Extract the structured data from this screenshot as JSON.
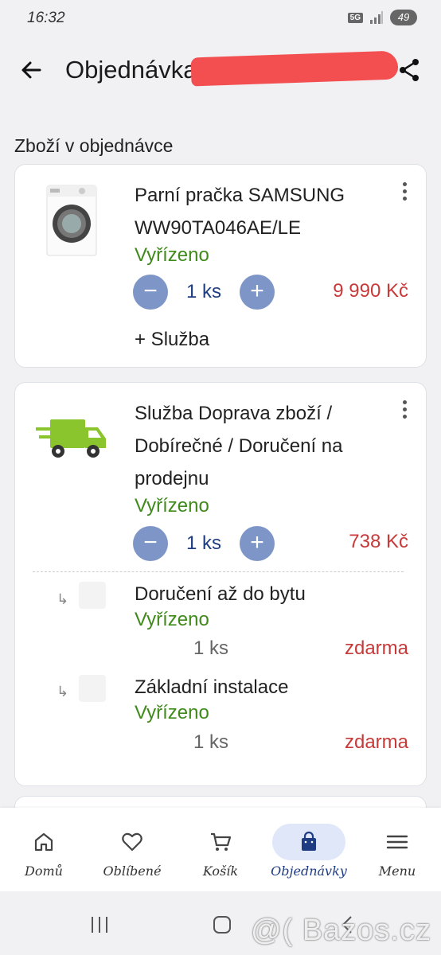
{
  "status_bar": {
    "time": "16:32",
    "network": "5G",
    "battery": "49"
  },
  "header": {
    "title": "Objednávka"
  },
  "section": {
    "title": "Zboží v objednávce"
  },
  "items": [
    {
      "name_line1": "Parní pračka SAMSUNG",
      "name_line2": "WW90TA046AE/LE",
      "status": "Vyřízeno",
      "qty": "1 ks",
      "price": "9 990 Kč",
      "minus": "−",
      "plus": "+",
      "add_service": "+ Služba"
    },
    {
      "name_line1": "Služba Doprava zboží /",
      "name_line2": "Dobírečné / Doručení na",
      "name_line3": "prodejnu",
      "status": "Vyřízeno",
      "qty": "1 ks",
      "price": "738 Kč",
      "minus": "−",
      "plus": "+",
      "sub_items": [
        {
          "arrow": "↳",
          "name": "Doručení až do bytu",
          "status": "Vyřízeno",
          "qty": "1 ks",
          "price": "zdarma"
        },
        {
          "arrow": "↳",
          "name": "Základní instalace",
          "status": "Vyřízeno",
          "qty": "1 ks",
          "price": "zdarma"
        }
      ]
    }
  ],
  "bottom_nav": [
    {
      "label": "Domů",
      "icon": "home-icon"
    },
    {
      "label": "Oblíbené",
      "icon": "heart-icon"
    },
    {
      "label": "Košík",
      "icon": "cart-icon"
    },
    {
      "label": "Objednávky",
      "icon": "bag-icon",
      "active": true
    },
    {
      "label": "Menu",
      "icon": "menu-icon"
    }
  ],
  "watermark": "@( Bazos.cz",
  "colors": {
    "status_green": "#3f8a1a",
    "price_red": "#c83a3a",
    "accent_blue": "#1e3c82",
    "button_blue": "#7d95c7",
    "truck_green": "#8bc52e"
  }
}
